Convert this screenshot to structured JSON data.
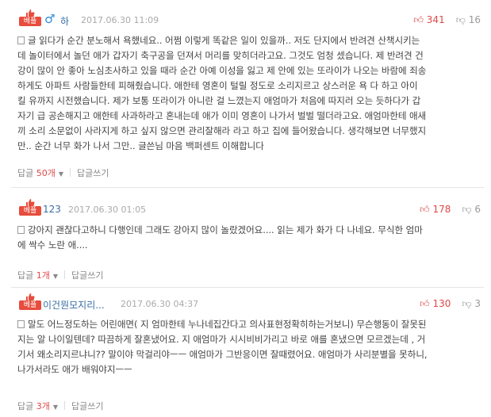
{
  "comments": [
    {
      "best_label": "베플",
      "gender_symbol": "♂",
      "nick": "하",
      "date": "2017.06.30 11:09",
      "up": "341",
      "down": "16",
      "lines": [
        "글 읽다가 순간 분노해서 욕했네요.. 어쩜 이렇게 똑같은 일이 있을까.. 저도 단지에서 반려견 산책시키는",
        "데 놀이터에서 놀던 애가 갑자기 축구공을 던져서 머리를 맞히더라고요. 그것도 엄청 셌습니다. 제 반려견 건",
        "강이 많이 안 좋아 노심초사하고 있을 때라 순간 아예 이성을 잃고 제 안에 있는 또라이가 나오는 바람에 죄송",
        "하게도 아파트 사람들한테 피해줬습니다. 애한테 영혼이 털릴 정도로 소리지르고 상스러운 욕 다 하고 아이",
        "킬 유까지 시전했습니다. 제가 보통 또라이가 아니란 걸 느꼈는지 애엄마가 처음에 따지러 오는 듯하다가 갑",
        "자기 급 공손해지고 애한테 사과하라고 혼내는데 애가 이미 영혼이 나가서 벌벌 떨더라고요. 애엄마한테 애새",
        "끼 소리 소문없이 사라지게 하고 싶지 않으면 관리잘해라 라고 하고 집에 들어왔습니다. 생각해보면 너무했지",
        "만.. 순간 너무 화가 나서 그만.. 글쓴님 마음 백퍼센트 이해합니다"
      ],
      "reply_label": "답글",
      "reply_count": "50개",
      "write_label": "답글쓰기"
    },
    {
      "best_label": "베플",
      "nick": "123",
      "date": "2017.06.30 01:05",
      "up": "178",
      "down": "6",
      "lines": [
        "강아지 괜찮다고하니 다행인데 그래도 강아지 많이 놀랐겠어요.... 읽는 제가 화가 다 나네요. 무식한 엄마",
        "에 싹수 노란 애...."
      ],
      "reply_label": "답글",
      "reply_count": "1개",
      "write_label": "답글쓰기"
    },
    {
      "best_label": "베플",
      "nick": "이건뭔모지리...",
      "date": "2017.06.30 04:37",
      "up": "130",
      "down": "3",
      "lines": [
        "말도 어느정도하는 어린애면( 지 엄마한테 누나네집간다고 의사표현정확히하는거보니) 무슨행동이 잘못된",
        "지는 알 나이일텐데? 따끔하게 잘혼냈어요. 지 애엄마가 시시비비가리고 바로 애를 혼냈으면 모르겠는데 , 거",
        "기서 왜소리지르냐니?? 말이야 막걸리야ㅡㅡ 애엄마가 그반응이면 잘때렸어요. 애엄마가 사리분별을 못하니,",
        "나가서라도 애가 배워야지ㅡㅡ"
      ],
      "reply_label": "답글",
      "reply_count": "3개",
      "write_label": "답글쓰기"
    }
  ]
}
